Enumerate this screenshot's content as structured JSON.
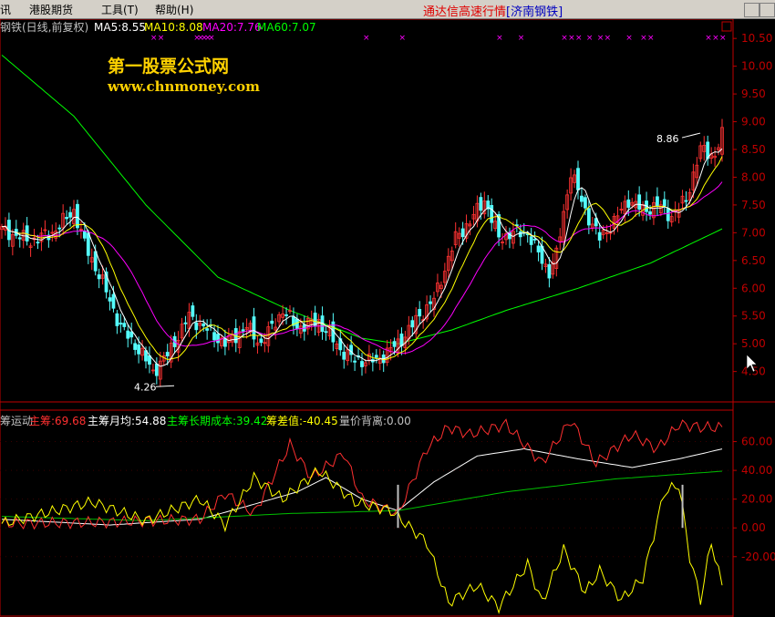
{
  "menu": {
    "items": [
      "讯",
      "港股期货",
      "工具(T)",
      "帮助(H)"
    ]
  },
  "app_title": {
    "prefix": "通达信高速行情",
    "stock": "[济南钢铁]"
  },
  "watermark": {
    "line1": "第一股票公式网",
    "line2": "www.chnmoney.com"
  },
  "main_panel": {
    "name_label": "钢铁(日线,前复权)",
    "indicators": [
      {
        "text": "MA5:8.55",
        "color": "#ffffff"
      },
      {
        "text": "MA10:8.08",
        "color": "#ffff00"
      },
      {
        "text": "MA20:7.76",
        "color": "#ff00ff"
      },
      {
        "text": "MA60:7.07",
        "color": "#00ff00"
      }
    ],
    "high_marker": "8.86",
    "low_marker": "4.26",
    "y_ticks": [
      "10.50",
      "10.00",
      "9.50",
      "9.00",
      "8.50",
      "8.00",
      "7.50",
      "7.00",
      "6.50",
      "6.00",
      "5.50",
      "5.00",
      "4.50"
    ]
  },
  "sub_panel": {
    "name_label": "筹运动",
    "indicators": [
      {
        "text": "主筹:69.68",
        "color": "#ff3030"
      },
      {
        "text": "主筹月均:54.88",
        "color": "#ffffff"
      },
      {
        "text": "主筹长期成本:39.42",
        "color": "#00ff00"
      },
      {
        "text": "筹差值:-40.45",
        "color": "#ffff00"
      },
      {
        "text": "量价背离:0.00",
        "color": "#c0c0c0"
      }
    ],
    "y_ticks": [
      "60.00",
      "40.00",
      "20.00",
      "0.00",
      "-20.00"
    ]
  },
  "colors": {
    "up": "#ff3232",
    "down": "#54fcfc",
    "ma5": "#ffffff",
    "ma10": "#ffff00",
    "ma20": "#ff00ff",
    "ma60": "#00ff00",
    "axis": "#c00000",
    "signal": "#ff00ff"
  },
  "chart_data": [
    {
      "type": "candlestick",
      "title": "钢铁(日线,前复权)",
      "ylim": [
        4.1,
        10.7
      ],
      "y_ticks": [
        10.5,
        10.0,
        9.5,
        9.0,
        8.5,
        8.0,
        7.5,
        7.0,
        6.5,
        6.0,
        5.5,
        5.0,
        4.5
      ],
      "high": 8.86,
      "low": 4.26,
      "close_anchors": [
        {
          "i": 0,
          "v": 7.05
        },
        {
          "i": 8,
          "v": 6.85
        },
        {
          "i": 14,
          "v": 7.0
        },
        {
          "i": 20,
          "v": 7.4
        },
        {
          "i": 23,
          "v": 6.8
        },
        {
          "i": 28,
          "v": 6.1
        },
        {
          "i": 33,
          "v": 5.3
        },
        {
          "i": 38,
          "v": 4.9
        },
        {
          "i": 42,
          "v": 4.5
        },
        {
          "i": 46,
          "v": 4.8
        },
        {
          "i": 52,
          "v": 5.5
        },
        {
          "i": 56,
          "v": 5.3
        },
        {
          "i": 62,
          "v": 5.0
        },
        {
          "i": 68,
          "v": 5.3
        },
        {
          "i": 72,
          "v": 5.0
        },
        {
          "i": 78,
          "v": 5.6
        },
        {
          "i": 82,
          "v": 5.3
        },
        {
          "i": 88,
          "v": 5.4
        },
        {
          "i": 94,
          "v": 4.9
        },
        {
          "i": 98,
          "v": 4.7
        },
        {
          "i": 104,
          "v": 4.7
        },
        {
          "i": 110,
          "v": 5.0
        },
        {
          "i": 116,
          "v": 5.5
        },
        {
          "i": 120,
          "v": 5.8
        },
        {
          "i": 126,
          "v": 6.9
        },
        {
          "i": 130,
          "v": 7.2
        },
        {
          "i": 134,
          "v": 7.6
        },
        {
          "i": 138,
          "v": 6.9
        },
        {
          "i": 142,
          "v": 7.0
        },
        {
          "i": 146,
          "v": 7.0
        },
        {
          "i": 150,
          "v": 6.5
        },
        {
          "i": 152,
          "v": 6.3
        },
        {
          "i": 154,
          "v": 6.6
        },
        {
          "i": 158,
          "v": 8.1
        },
        {
          "i": 162,
          "v": 7.4
        },
        {
          "i": 166,
          "v": 6.9
        },
        {
          "i": 170,
          "v": 7.2
        },
        {
          "i": 174,
          "v": 7.6
        },
        {
          "i": 178,
          "v": 7.4
        },
        {
          "i": 182,
          "v": 7.5
        },
        {
          "i": 186,
          "v": 7.3
        },
        {
          "i": 190,
          "v": 7.6
        },
        {
          "i": 194,
          "v": 8.5
        },
        {
          "i": 198,
          "v": 8.4
        },
        {
          "i": 200,
          "v": 8.75
        }
      ],
      "ma60_anchors": [
        {
          "i": 0,
          "v": 10.2
        },
        {
          "i": 20,
          "v": 9.1
        },
        {
          "i": 40,
          "v": 7.5
        },
        {
          "i": 60,
          "v": 6.2
        },
        {
          "i": 80,
          "v": 5.6
        },
        {
          "i": 100,
          "v": 5.1
        },
        {
          "i": 110,
          "v": 5.0
        },
        {
          "i": 125,
          "v": 5.25
        },
        {
          "i": 140,
          "v": 5.6
        },
        {
          "i": 160,
          "v": 6.0
        },
        {
          "i": 180,
          "v": 6.45
        },
        {
          "i": 200,
          "v": 7.07
        }
      ],
      "series": [
        {
          "name": "MA5",
          "last": 8.55
        },
        {
          "name": "MA10",
          "last": 8.08
        },
        {
          "name": "MA20",
          "last": 7.76
        },
        {
          "name": "MA60",
          "last": 7.07
        }
      ],
      "signal_days": [
        42,
        44,
        54,
        55,
        56,
        57,
        58,
        101,
        111,
        138,
        144,
        156,
        158,
        160,
        163,
        166,
        168,
        174,
        178,
        180,
        196,
        198,
        200
      ]
    },
    {
      "type": "line",
      "title": "筹运动",
      "ylim": [
        -55,
        80
      ],
      "y_ticks": [
        60,
        40,
        20,
        0,
        -20
      ],
      "series": [
        {
          "name": "主筹",
          "last": 69.68,
          "anchors": [
            {
              "i": 0,
              "v": 3
            },
            {
              "i": 30,
              "v": 4
            },
            {
              "i": 55,
              "v": 6
            },
            {
              "i": 62,
              "v": 24
            },
            {
              "i": 70,
              "v": 10
            },
            {
              "i": 80,
              "v": 58
            },
            {
              "i": 86,
              "v": 35
            },
            {
              "i": 95,
              "v": 52
            },
            {
              "i": 100,
              "v": 20
            },
            {
              "i": 110,
              "v": 10
            },
            {
              "i": 118,
              "v": 55
            },
            {
              "i": 124,
              "v": 70
            },
            {
              "i": 130,
              "v": 65
            },
            {
              "i": 140,
              "v": 72
            },
            {
              "i": 150,
              "v": 45
            },
            {
              "i": 158,
              "v": 75
            },
            {
              "i": 165,
              "v": 45
            },
            {
              "i": 175,
              "v": 65
            },
            {
              "i": 182,
              "v": 55
            },
            {
              "i": 188,
              "v": 72
            },
            {
              "i": 194,
              "v": 70
            },
            {
              "i": 200,
              "v": 69.68
            }
          ]
        },
        {
          "name": "主筹月均",
          "last": 54.88,
          "anchors": [
            {
              "i": 0,
              "v": 6
            },
            {
              "i": 30,
              "v": 2
            },
            {
              "i": 55,
              "v": 6
            },
            {
              "i": 68,
              "v": 15
            },
            {
              "i": 82,
              "v": 25
            },
            {
              "i": 90,
              "v": 35
            },
            {
              "i": 100,
              "v": 20
            },
            {
              "i": 110,
              "v": 12
            },
            {
              "i": 120,
              "v": 32
            },
            {
              "i": 132,
              "v": 50
            },
            {
              "i": 145,
              "v": 55
            },
            {
              "i": 160,
              "v": 48
            },
            {
              "i": 175,
              "v": 42
            },
            {
              "i": 188,
              "v": 48
            },
            {
              "i": 200,
              "v": 54.88
            }
          ]
        },
        {
          "name": "主筹长期成本",
          "last": 39.42,
          "anchors": [
            {
              "i": 0,
              "v": 8
            },
            {
              "i": 40,
              "v": 5
            },
            {
              "i": 80,
              "v": 10
            },
            {
              "i": 110,
              "v": 12
            },
            {
              "i": 140,
              "v": 25
            },
            {
              "i": 170,
              "v": 34
            },
            {
              "i": 200,
              "v": 39.42
            }
          ]
        },
        {
          "name": "筹差值",
          "last": -40.45,
          "anchors": [
            {
              "i": 0,
              "v": 3
            },
            {
              "i": 25,
              "v": 18
            },
            {
              "i": 40,
              "v": 5
            },
            {
              "i": 55,
              "v": 20
            },
            {
              "i": 62,
              "v": 2
            },
            {
              "i": 70,
              "v": 35
            },
            {
              "i": 78,
              "v": 20
            },
            {
              "i": 88,
              "v": 40
            },
            {
              "i": 98,
              "v": 18
            },
            {
              "i": 108,
              "v": 12
            },
            {
              "i": 118,
              "v": -10
            },
            {
              "i": 124,
              "v": -52
            },
            {
              "i": 132,
              "v": -40
            },
            {
              "i": 138,
              "v": -55
            },
            {
              "i": 146,
              "v": -25
            },
            {
              "i": 150,
              "v": -52
            },
            {
              "i": 156,
              "v": -15
            },
            {
              "i": 162,
              "v": -45
            },
            {
              "i": 166,
              "v": -30
            },
            {
              "i": 172,
              "v": -50
            },
            {
              "i": 178,
              "v": -35
            },
            {
              "i": 184,
              "v": 25
            },
            {
              "i": 188,
              "v": 30
            },
            {
              "i": 191,
              "v": -20
            },
            {
              "i": 194,
              "v": -50
            },
            {
              "i": 197,
              "v": -10
            },
            {
              "i": 200,
              "v": -40.45
            }
          ]
        },
        {
          "name": "量价背离",
          "last": 0.0,
          "bars": [
            {
              "i": 110,
              "v": 30
            },
            {
              "i": 189,
              "v": 30
            }
          ]
        }
      ]
    }
  ]
}
